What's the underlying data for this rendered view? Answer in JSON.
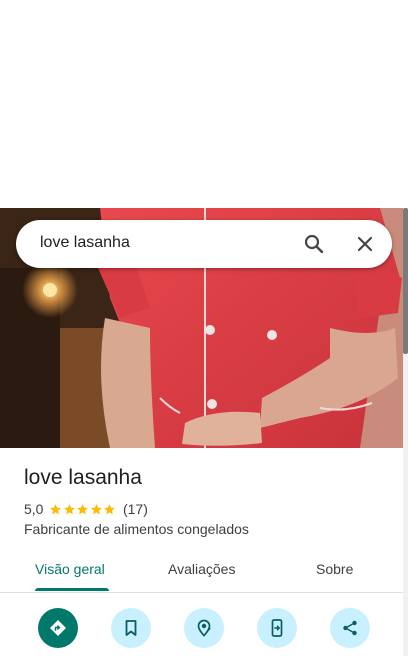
{
  "search": {
    "query": "love lasanha"
  },
  "place": {
    "name": "love lasanha",
    "rating": "5,0",
    "review_count": "(17)",
    "stars": 5,
    "category": "Fabricante de alimentos congelados"
  },
  "tabs": [
    {
      "label": "Visão geral",
      "active": true
    },
    {
      "label": "Avaliações",
      "active": false
    },
    {
      "label": "Sobre",
      "active": false
    }
  ],
  "actions": [
    {
      "icon": "directions-icon"
    },
    {
      "icon": "bookmark-icon"
    },
    {
      "icon": "nearby-icon"
    },
    {
      "icon": "send-to-phone-icon"
    },
    {
      "icon": "share-icon"
    }
  ],
  "colors": {
    "accent": "#00796b",
    "star": "#fbbc04",
    "action_bg": "#c9f0ff"
  }
}
